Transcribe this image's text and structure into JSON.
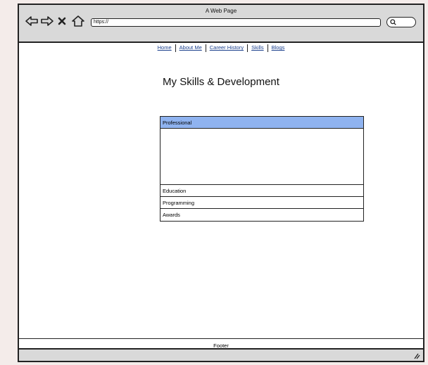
{
  "window": {
    "title": "A Web Page"
  },
  "toolbar": {
    "url": "https://"
  },
  "nav": {
    "links": [
      "Home",
      "About Me",
      "Career History",
      "Skills",
      "Blogs"
    ]
  },
  "page": {
    "title": "My Skills & Development"
  },
  "accordion": {
    "sections": [
      "Professional",
      "Education",
      "Programming",
      "Awards"
    ],
    "active_index": 0
  },
  "footer": {
    "label": "Footer"
  },
  "colors": {
    "accordion_active": "#8fb3f0",
    "link": "#1a3f8c",
    "chrome": "#d9d9d9"
  }
}
